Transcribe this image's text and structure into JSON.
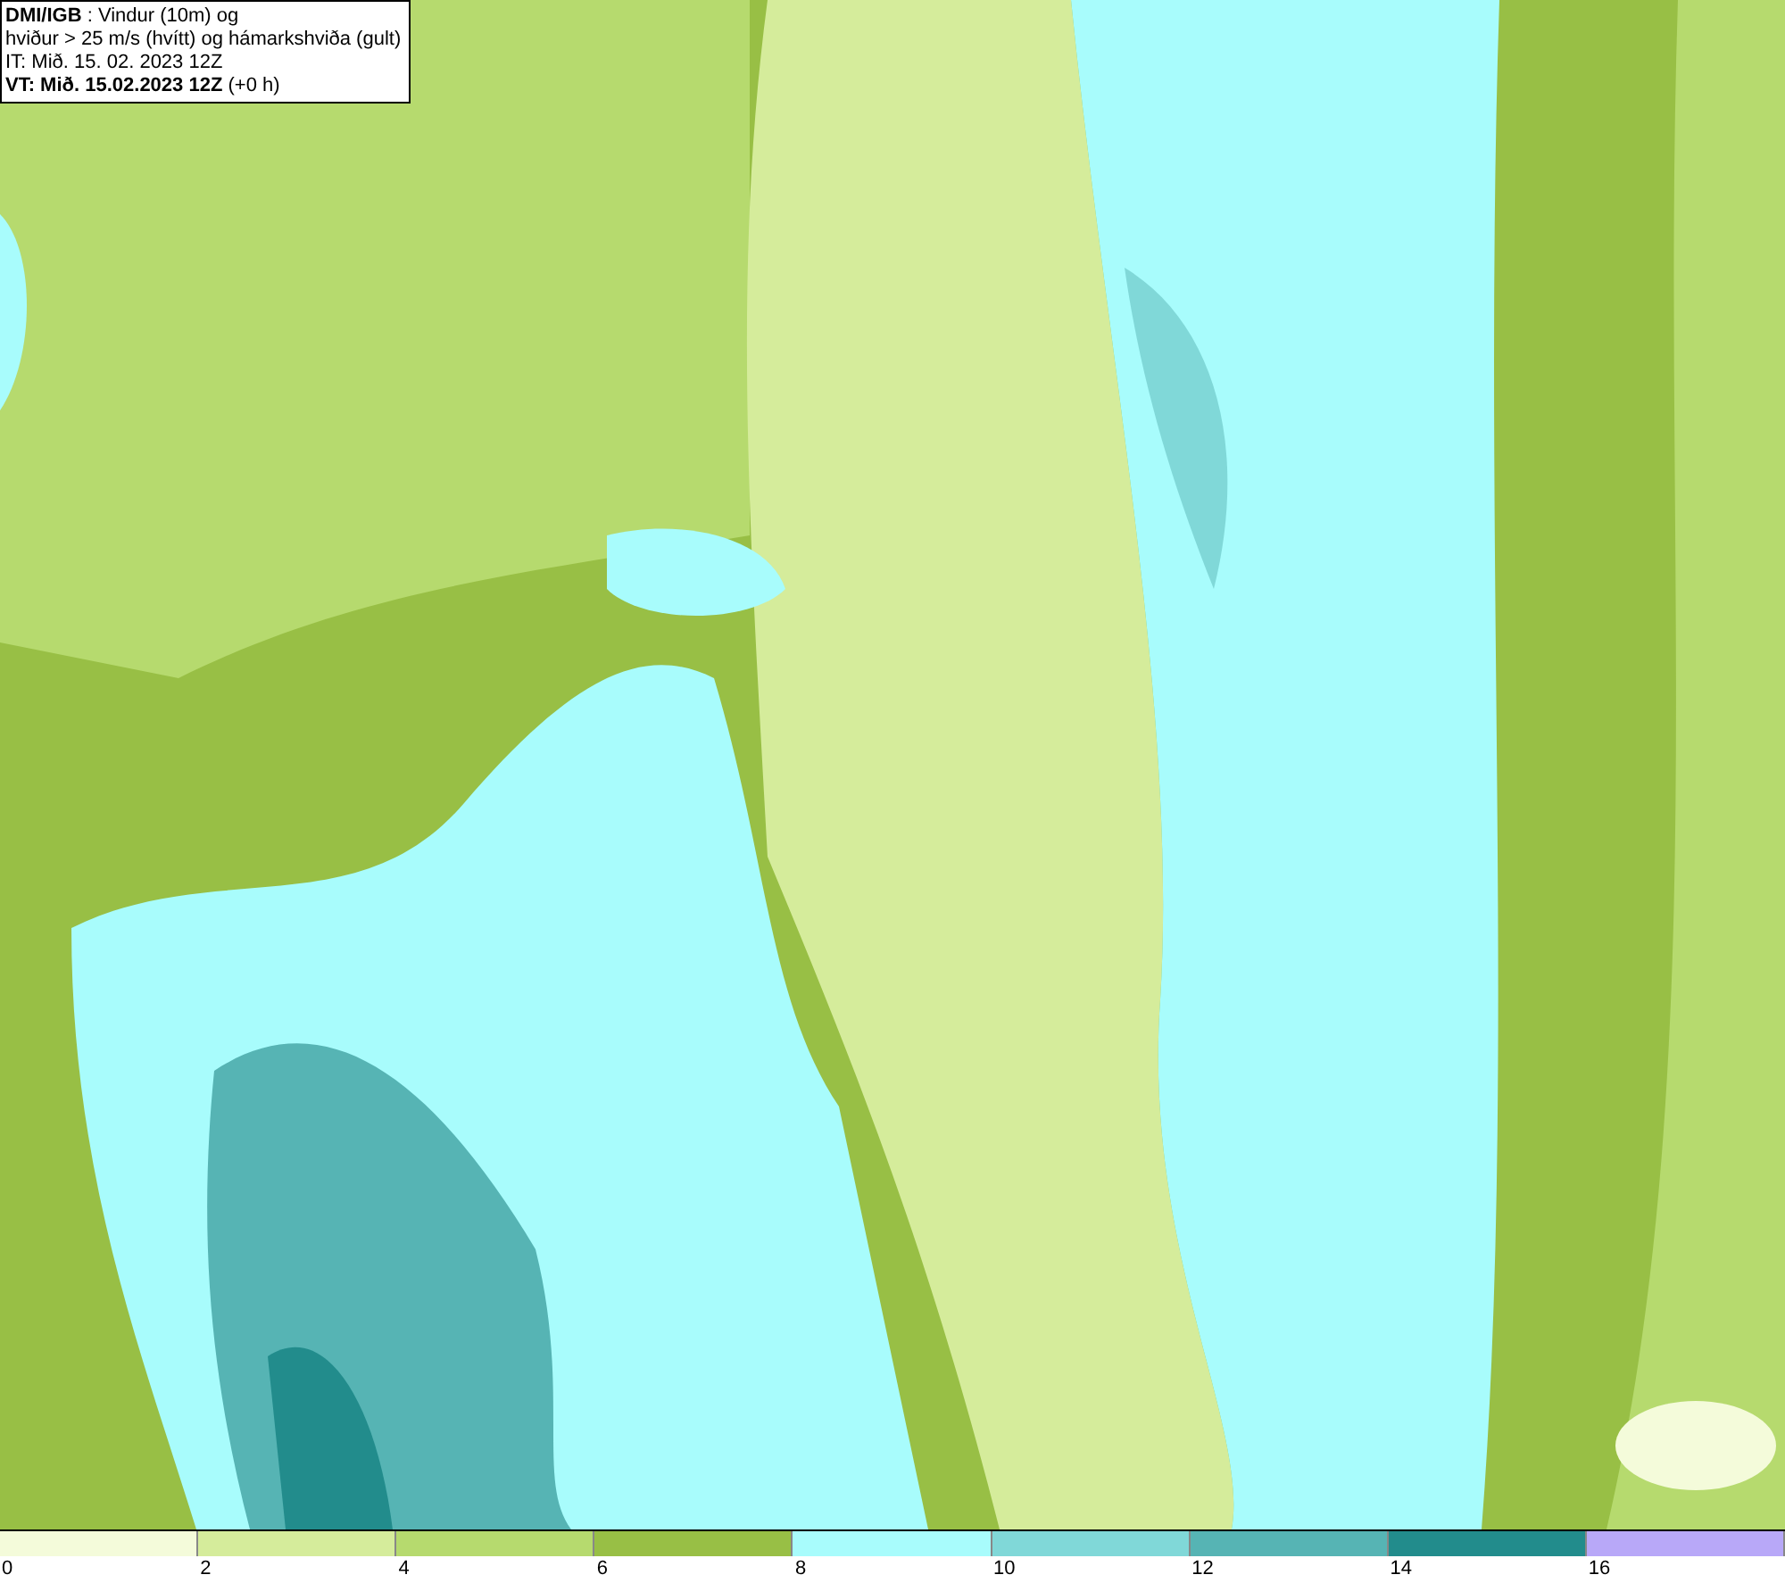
{
  "header": {
    "line1": "**DMI/IGB** : Vindur (10m) og",
    "line2": "hviður > 25 m/s (hvítt) og hámarkshviða (gult)",
    "line3": "IT: Mið. 15. 02. 2023 12Z",
    "line4": "**VT: Mið. 15.02.2023 12Z** (+0 h)"
  },
  "legend": [
    {
      "label": "0",
      "color": "#f4fbda"
    },
    {
      "label": "2",
      "color": "#d5ec9b"
    },
    {
      "label": "4",
      "color": "#b6da6e"
    },
    {
      "label": "6",
      "color": "#98bf45"
    },
    {
      "label": "8",
      "color": "#a8fcfc"
    },
    {
      "label": "10",
      "color": "#80d8d8"
    },
    {
      "label": "12",
      "color": "#56b4b4"
    },
    {
      "label": "14",
      "color": "#228c8c"
    },
    {
      "label": "16",
      "color": "#b8a8f8"
    }
  ]
}
